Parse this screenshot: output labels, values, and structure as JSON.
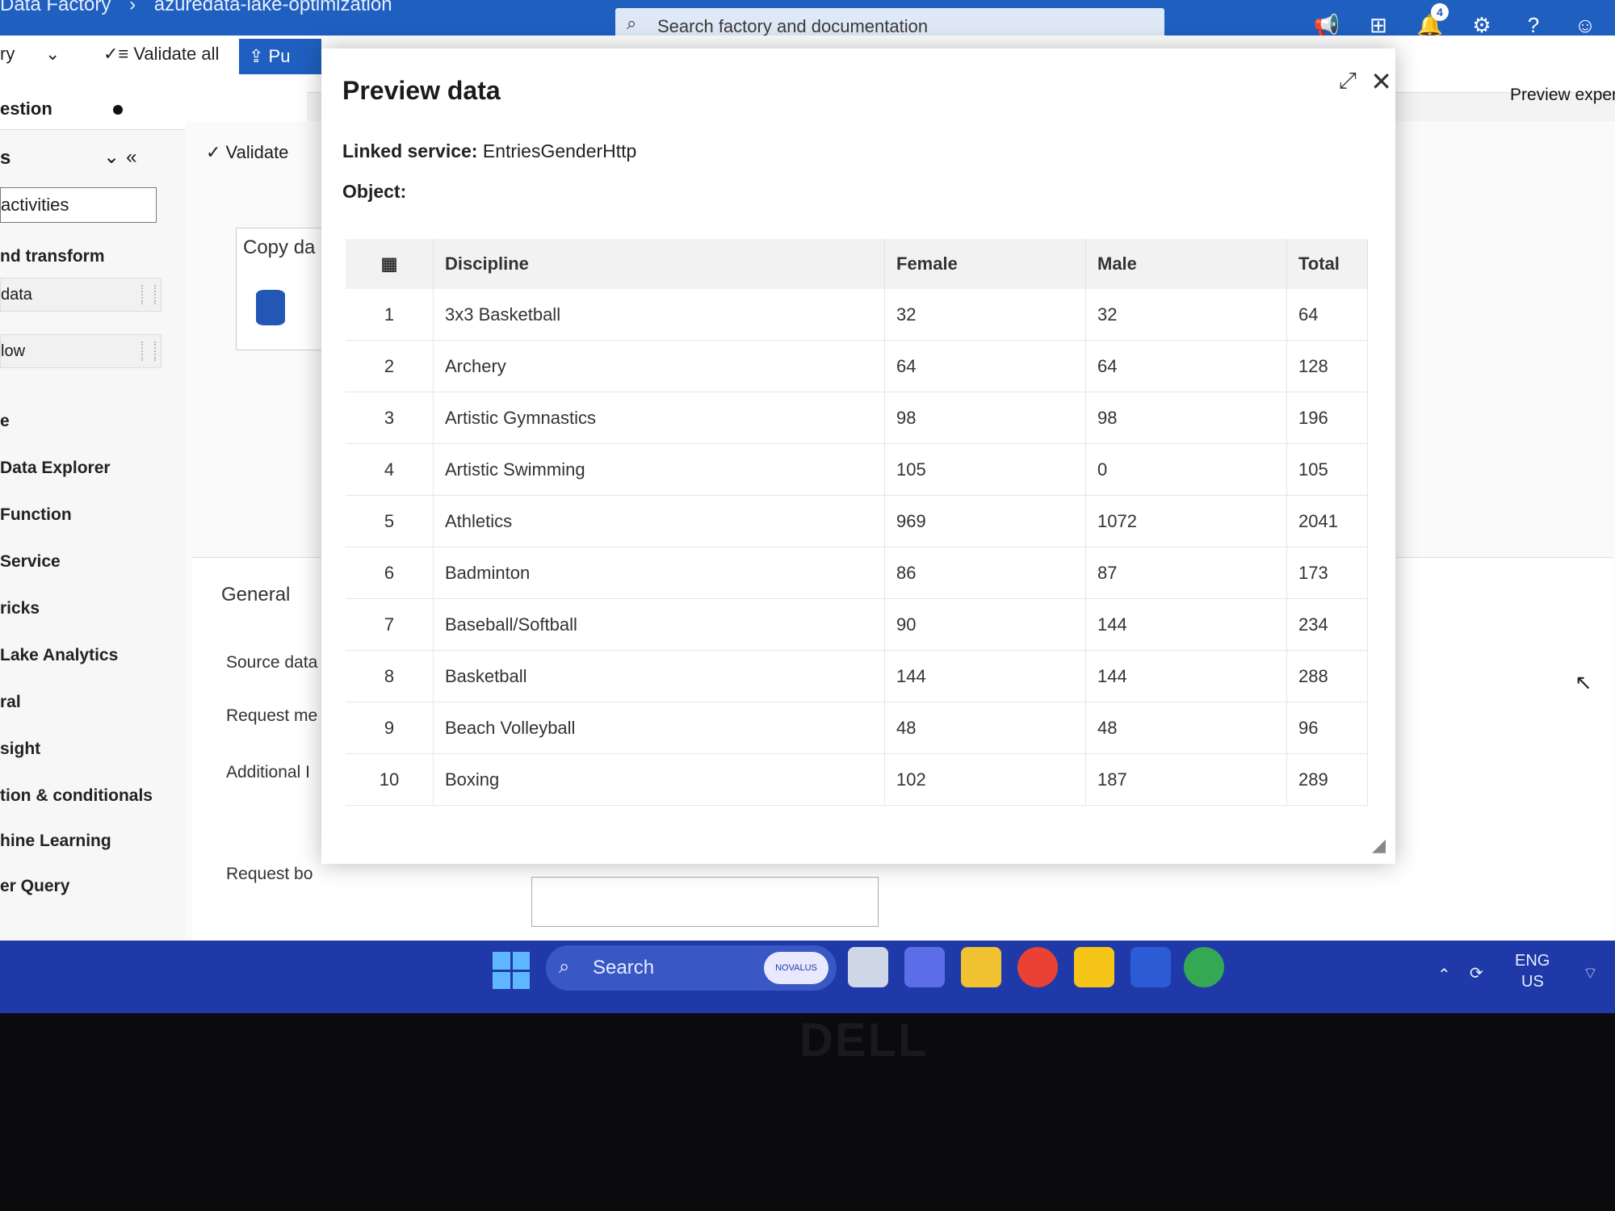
{
  "topbar": {
    "breadcrumb_app": "Data Factory",
    "breadcrumb_factory": "azuredata-lake-optimization",
    "search_placeholder": "Search factory and documentation",
    "notification_count": "4"
  },
  "toolbar": {
    "left_fragment": "ry",
    "validate_all": "Validate all",
    "publish_fragment": "Pu"
  },
  "left_panel": {
    "tab_label": "estion",
    "header": "s",
    "search_value": "activities",
    "items": [
      "nd transform",
      "data",
      "low",
      "e",
      "Data Explorer",
      "Function",
      "Service",
      "ricks",
      "Lake Analytics",
      "ral",
      "sight",
      "tion & conditionals",
      "hine Learning",
      "er Query"
    ]
  },
  "canvas": {
    "validate_label": "Validate",
    "copy_card_title": "Copy da",
    "preview_experience": "Preview experi",
    "props": {
      "general_tab": "General",
      "source_dataset": "Source data",
      "request_method": "Request me",
      "additional": "Additional I",
      "request_body": "Request bo"
    }
  },
  "dialog": {
    "title": "Preview data",
    "linked_service_label": "Linked service:",
    "linked_service_value": "EntriesGenderHttp",
    "object_label": "Object:",
    "columns": [
      "Discipline",
      "Female",
      "Male",
      "Total"
    ],
    "rows": [
      {
        "idx": "1",
        "discipline": "3x3 Basketball",
        "female": "32",
        "male": "32",
        "total": "64"
      },
      {
        "idx": "2",
        "discipline": "Archery",
        "female": "64",
        "male": "64",
        "total": "128"
      },
      {
        "idx": "3",
        "discipline": "Artistic Gymnastics",
        "female": "98",
        "male": "98",
        "total": "196"
      },
      {
        "idx": "4",
        "discipline": "Artistic Swimming",
        "female": "105",
        "male": "0",
        "total": "105"
      },
      {
        "idx": "5",
        "discipline": "Athletics",
        "female": "969",
        "male": "1072",
        "total": "2041"
      },
      {
        "idx": "6",
        "discipline": "Badminton",
        "female": "86",
        "male": "87",
        "total": "173"
      },
      {
        "idx": "7",
        "discipline": "Baseball/Softball",
        "female": "90",
        "male": "144",
        "total": "234"
      },
      {
        "idx": "8",
        "discipline": "Basketball",
        "female": "144",
        "male": "144",
        "total": "288"
      },
      {
        "idx": "9",
        "discipline": "Beach Volleyball",
        "female": "48",
        "male": "48",
        "total": "96"
      },
      {
        "idx": "10",
        "discipline": "Boxing",
        "female": "102",
        "male": "187",
        "total": "289"
      }
    ]
  },
  "taskbar": {
    "search_label": "Search",
    "search_pill": "NOVALUS",
    "lang_line1": "ENG",
    "lang_line2": "US"
  },
  "bezel": {
    "brand": "DELL"
  }
}
